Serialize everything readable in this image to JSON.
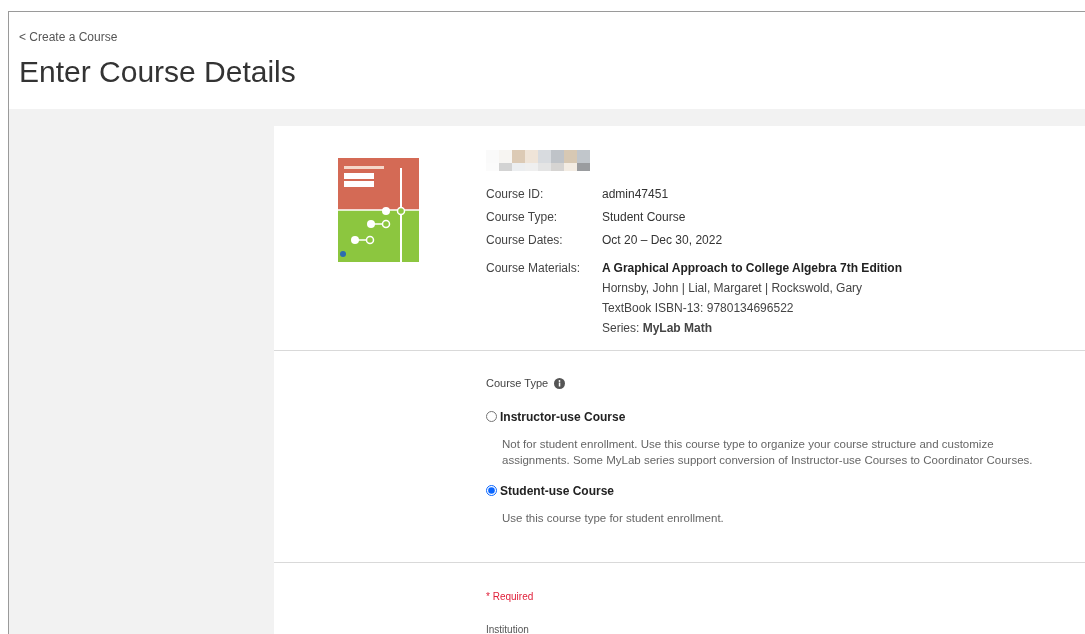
{
  "back_link": "< Create a Course",
  "title": "Enter Course Details",
  "summary": {
    "fields": [
      {
        "label": "Course ID:",
        "value": "admin47451"
      },
      {
        "label": "Course Type:",
        "value": "Student Course"
      },
      {
        "label": "Course Dates:",
        "value": "Oct 20 – Dec 30, 2022"
      }
    ],
    "materials": {
      "label": "Course Materials:",
      "title": "A Graphical Approach to College Algebra 7th Edition",
      "authors": "Hornsby, John | Lial, Margaret | Rockswold, Gary",
      "isbn": "TextBook ISBN-13: 9780134696522",
      "series": "Series: **MyLab Math**"
    }
  },
  "course_type": {
    "label": "Course Type",
    "options": [
      {
        "label": "Instructor-use Course",
        "description": "Not for student enrollment. Use this course type to organize your course structure and customize assignments. Some MyLab series support conversion of Instructor-use Courses to Coordinator Courses.",
        "selected": false
      },
      {
        "label": "Student-use Course",
        "description": "Use this course type for student enrollment.",
        "selected": true
      }
    ]
  },
  "form": {
    "required_note": "* Required",
    "institution_label": "Institution"
  }
}
